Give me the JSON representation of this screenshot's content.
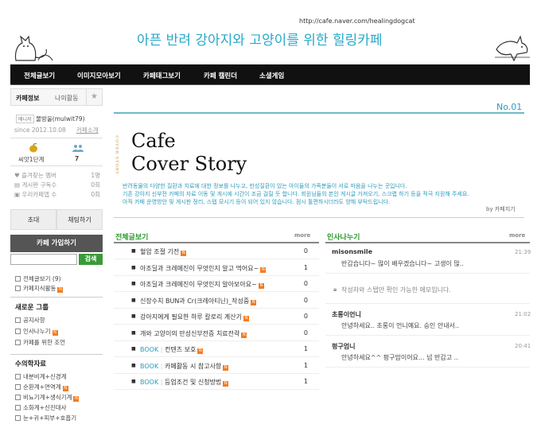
{
  "header": {
    "url": "http://cafe.naver.com/healingdogcat",
    "title": "아픈 반려 강아지와 고양이를 위한 힐링카페"
  },
  "nav": [
    {
      "label": "전체글보기"
    },
    {
      "label": "이미지모아보기"
    },
    {
      "label": "카페태그보기"
    },
    {
      "label": "카페 캘린더"
    },
    {
      "label": "소셜게임"
    }
  ],
  "sidebar": {
    "tab_info": "카페정보",
    "tab_activity": "나의활동",
    "manager_tag": "매니저",
    "manager_name": "물방울(mulwit79)",
    "since": "since 2012.10.08",
    "intro_link": "카페소개",
    "level": "씨앗1단계",
    "members": "7",
    "stats": [
      {
        "label": "즐겨찾는 멤버",
        "value": "1명"
      },
      {
        "label": "게시판 구독수",
        "value": "0회"
      },
      {
        "label": "우리카페앱 수",
        "value": "0회"
      }
    ],
    "invite": "초대",
    "chat": "채팅하기",
    "join": "카페 가입하기",
    "search_btn": "검색",
    "boards_top": [
      {
        "label": "전체글보기",
        "count": "(9)"
      },
      {
        "label": "카페지식활동"
      }
    ],
    "group_title": "새로운 그룹",
    "boards_group": [
      {
        "label": "공지사항"
      },
      {
        "label": "인사나누기"
      },
      {
        "label": "카페를 위한 조언"
      }
    ],
    "data_title": "수의학자료",
    "boards_data": [
      {
        "label": "내분비계+신경계"
      },
      {
        "label": "순환계+면역계"
      },
      {
        "label": "비뇨기계+생식기계"
      },
      {
        "label": "소화계+신진대사"
      },
      {
        "label": "눈+귀+피부+호흡기"
      }
    ]
  },
  "main": {
    "no": "No.01",
    "vertical": "COVER STORY",
    "cover_line1": "Cafe",
    "cover_line2": "Cover Story",
    "intro_lines": [
      "반려동물의 다양한 질환과 치료에 대한 정보를 나누고, 만성질환이 있는 아이들의 가족분들이 서로 마음을 나누는 곳입니다.",
      "기존 강아지 신부전 카페의 자료 이동 및 게시에 시간이 조금 걸릴 듯 합니다. 회원님들의 본인 게시글 가져오기, 스크랩 하기 등을 적극 지원해 주세요.",
      "아직 카페 운영방안 및 게시판 정리, 스탭 모시기 등이 되어 있지 않습니다. 점시 툴편하시더라도 양해 부탁드립니다."
    ],
    "sign": "by 카페지기"
  },
  "board_all": {
    "title": "전체글보기",
    "more": "more",
    "posts": [
      {
        "prefix": "",
        "title": "혈압 조절 기전",
        "n": true,
        "count": "0"
      },
      {
        "prefix": "",
        "title": "아조딜과 크레메진이 무엇인지 알고 먹어요~",
        "n": true,
        "count": "1"
      },
      {
        "prefix": "",
        "title": "아조딜과 크레메진이 무엇인지 알아보아요~",
        "n": true,
        "count": "0"
      },
      {
        "prefix": "",
        "title": "신장수치 BUN과 Cr(크레아티닌)_작성중",
        "n": true,
        "count": "0"
      },
      {
        "prefix": "",
        "title": "강아지에게 필요한 하루 칼로리 계산기",
        "n": true,
        "count": "0"
      },
      {
        "prefix": "",
        "title": "개와 고양이의 만성신부전증 치료전략",
        "n": true,
        "count": "0"
      },
      {
        "prefix": "BOOK",
        "title": "컨텐츠 보호",
        "n": true,
        "count": "1"
      },
      {
        "prefix": "BOOK",
        "title": "카페활동 시 참고사항",
        "n": true,
        "count": "1"
      },
      {
        "prefix": "BOOK",
        "title": "등업조건 및 신청방법",
        "n": true,
        "count": "1"
      }
    ]
  },
  "board_hello": {
    "title": "인사나누기",
    "more": "more",
    "comments": [
      {
        "name": "misonsmile",
        "time": "21:39",
        "body": "반갑습니다~ 많이 배우겠습니다~ 고생이 많.."
      },
      {
        "name": "",
        "time": "",
        "body": "작성자와 스탭만 확인 가능한 메모입니다."
      },
      {
        "name": "초롱이언니",
        "time": "21:02",
        "body": "안녕하세요.. 초롱이 언니예요. 승인 안내서.."
      },
      {
        "name": "펑구엄니",
        "time": "20:41",
        "body": "안녕하세요^^ 펑구맘이어요... 넘 반갑고 .."
      }
    ]
  },
  "colors": {
    "accent": "#29a8c9",
    "nav_bg": "#111111",
    "board_green": "#2a9a2a",
    "badge_orange": "#f47c20"
  }
}
